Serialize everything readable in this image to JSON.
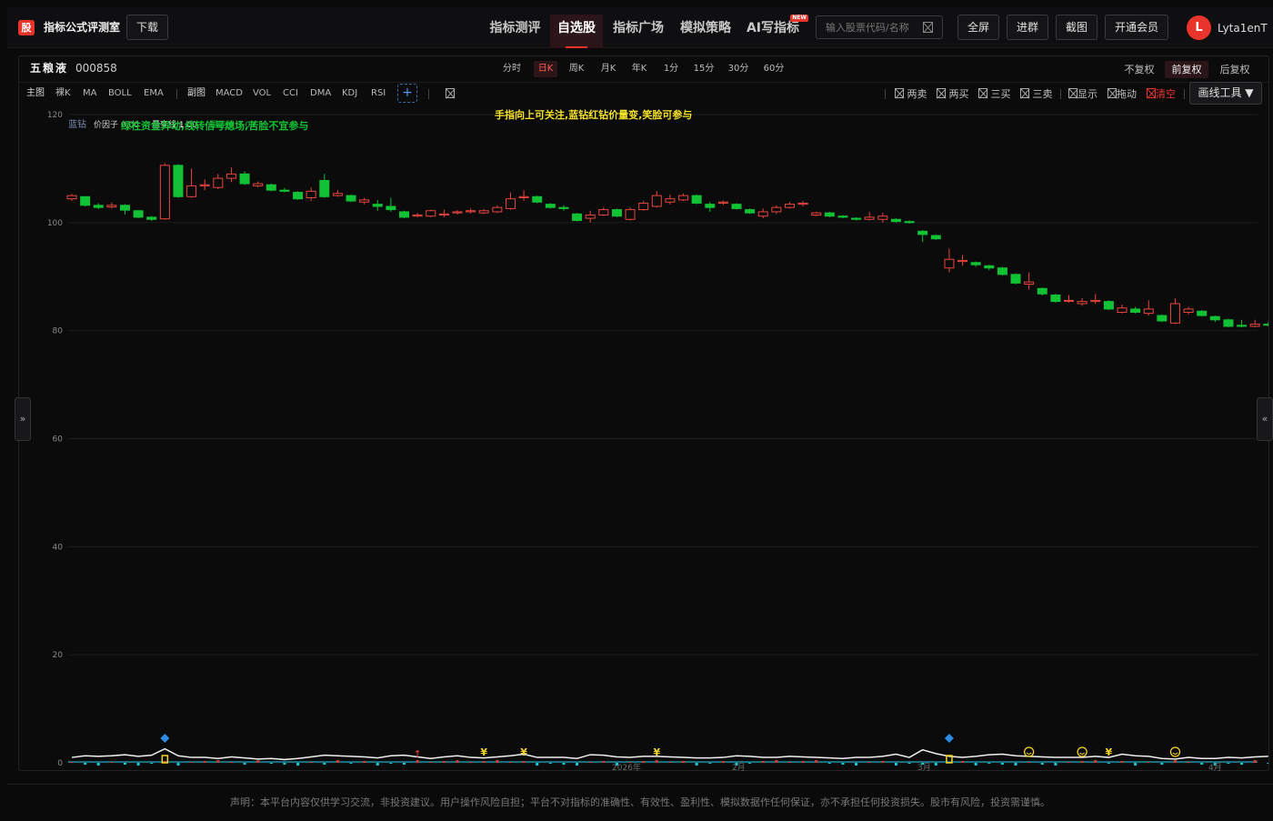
{
  "header": {
    "logo_text": "股",
    "app_title": "指标公式评测室",
    "download_label": "下载",
    "nav": [
      {
        "label": "指标测评",
        "active": false
      },
      {
        "label": "自选股",
        "active": true
      },
      {
        "label": "指标广场",
        "active": false
      },
      {
        "label": "模拟策略",
        "active": false
      },
      {
        "label": "AI写指标",
        "active": false,
        "badge": "NEW"
      }
    ],
    "search_placeholder": "输入股票代码/名称",
    "fullscreen_label": "全屏",
    "join_group_label": "进群",
    "screenshot_label": "截图",
    "membership_label": "开通会员",
    "avatar_letter": "L",
    "username": "Lyta1enT"
  },
  "stock": {
    "name": "五粮液",
    "code": "000858"
  },
  "periods": [
    {
      "label": "分时",
      "active": false
    },
    {
      "label": "日K",
      "active": true
    },
    {
      "label": "周K",
      "active": false
    },
    {
      "label": "月K",
      "active": false
    },
    {
      "label": "年K",
      "active": false
    },
    {
      "label": "1分",
      "active": false
    },
    {
      "label": "15分",
      "active": false
    },
    {
      "label": "30分",
      "active": false
    },
    {
      "label": "60分",
      "active": false
    }
  ],
  "adjustments": [
    {
      "label": "不复权",
      "active": false
    },
    {
      "label": "前复权",
      "active": true
    },
    {
      "label": "后复权",
      "active": false
    }
  ],
  "indicators": {
    "main_label": "主图",
    "main": [
      "裸K",
      "MA",
      "BOLL",
      "EMA"
    ],
    "sub_label": "副图",
    "sub": [
      "MACD",
      "VOL",
      "CCI",
      "DMA",
      "KDJ",
      "RSI"
    ],
    "add_label": "+"
  },
  "tools": [
    {
      "label": "两卖",
      "red": false
    },
    {
      "label": "两买",
      "red": false
    },
    {
      "label": "三买",
      "red": false
    },
    {
      "label": "三卖",
      "red": false
    },
    {
      "label": "显示",
      "red": false
    },
    {
      "label": "拖动",
      "red": false
    },
    {
      "label": "清空",
      "red": true
    }
  ],
  "draw_tools_label": "画线工具",
  "overlay": {
    "indicator_name": "蓝钻",
    "param1": "价因子 0.00",
    "param2": "量变线 1.00",
    "param3": "量能线 1.00",
    "green_text": "绿柱资金异动,线转信号熄场,苦脸不宜参与",
    "yellow_text": "手指向上可关注,蓝钻红钻价量变,笑脸可参与"
  },
  "colors": {
    "up": "#e8453c",
    "down": "#11c234",
    "accent": "#e8342b",
    "grid": "#1d1d20",
    "signal_yellow": "#f5d426",
    "signal_blue": "#2d8be0"
  },
  "chart_data": {
    "type": "candlestick",
    "y_axis": {
      "min": 0,
      "max": 120,
      "ticks": [
        0,
        20,
        40,
        60,
        80,
        100,
        120
      ]
    },
    "x_tick_labels": [
      "2026年",
      "2月",
      "3月",
      "4月"
    ],
    "candles": [
      {
        "o": 104.4,
        "c": 105.0,
        "h": 105.3,
        "l": 104.0
      },
      {
        "o": 104.8,
        "c": 103.2,
        "h": 104.9,
        "l": 103.0
      },
      {
        "o": 103.2,
        "c": 102.8,
        "h": 103.6,
        "l": 102.5
      },
      {
        "o": 102.9,
        "c": 103.2,
        "h": 103.7,
        "l": 102.6
      },
      {
        "o": 103.2,
        "c": 102.3,
        "h": 103.4,
        "l": 101.5
      },
      {
        "o": 102.2,
        "c": 101.0,
        "h": 102.3,
        "l": 100.8
      },
      {
        "o": 101.0,
        "c": 100.6,
        "h": 101.2,
        "l": 100.3
      },
      {
        "o": 100.7,
        "c": 110.6,
        "h": 111.0,
        "l": 100.5
      },
      {
        "o": 110.6,
        "c": 104.8,
        "h": 110.8,
        "l": 104.6
      },
      {
        "o": 104.8,
        "c": 106.8,
        "h": 110.0,
        "l": 104.6
      },
      {
        "o": 106.8,
        "c": 107.0,
        "h": 108.0,
        "l": 106.0
      },
      {
        "o": 106.5,
        "c": 108.2,
        "h": 109.0,
        "l": 106.2
      },
      {
        "o": 108.2,
        "c": 109.0,
        "h": 110.2,
        "l": 107.5
      },
      {
        "o": 109.0,
        "c": 107.2,
        "h": 109.5,
        "l": 107.0
      },
      {
        "o": 106.8,
        "c": 107.2,
        "h": 107.6,
        "l": 106.5
      },
      {
        "o": 107.0,
        "c": 106.0,
        "h": 107.2,
        "l": 105.8
      },
      {
        "o": 106.0,
        "c": 105.8,
        "h": 106.4,
        "l": 105.6
      },
      {
        "o": 105.6,
        "c": 104.4,
        "h": 105.8,
        "l": 104.2
      },
      {
        "o": 104.6,
        "c": 105.8,
        "h": 106.5,
        "l": 104.0
      },
      {
        "o": 107.8,
        "c": 104.8,
        "h": 109.0,
        "l": 104.6
      },
      {
        "o": 105.0,
        "c": 105.4,
        "h": 106.0,
        "l": 104.8
      },
      {
        "o": 105.0,
        "c": 104.0,
        "h": 105.2,
        "l": 103.8
      },
      {
        "o": 103.8,
        "c": 104.2,
        "h": 104.6,
        "l": 103.4
      },
      {
        "o": 103.4,
        "c": 103.0,
        "h": 104.2,
        "l": 102.2
      },
      {
        "o": 103.0,
        "c": 102.4,
        "h": 104.6,
        "l": 102.0
      },
      {
        "o": 102.0,
        "c": 101.0,
        "h": 102.2,
        "l": 100.8
      },
      {
        "o": 101.2,
        "c": 101.4,
        "h": 101.8,
        "l": 101.0
      },
      {
        "o": 101.2,
        "c": 102.2,
        "h": 102.4,
        "l": 101.0
      },
      {
        "o": 101.4,
        "c": 101.6,
        "h": 102.4,
        "l": 101.0
      },
      {
        "o": 101.8,
        "c": 102.0,
        "h": 102.3,
        "l": 101.5
      },
      {
        "o": 102.0,
        "c": 102.2,
        "h": 102.6,
        "l": 101.7
      },
      {
        "o": 101.8,
        "c": 102.2,
        "h": 102.5,
        "l": 101.6
      },
      {
        "o": 102.0,
        "c": 102.8,
        "h": 103.2,
        "l": 101.8
      },
      {
        "o": 102.6,
        "c": 104.4,
        "h": 105.6,
        "l": 102.4
      },
      {
        "o": 104.6,
        "c": 104.8,
        "h": 106.0,
        "l": 104.0
      },
      {
        "o": 104.8,
        "c": 103.8,
        "h": 105.0,
        "l": 103.6
      },
      {
        "o": 103.4,
        "c": 102.8,
        "h": 103.6,
        "l": 102.6
      },
      {
        "o": 102.8,
        "c": 102.6,
        "h": 103.2,
        "l": 102.2
      },
      {
        "o": 101.6,
        "c": 100.4,
        "h": 101.8,
        "l": 100.2
      },
      {
        "o": 100.8,
        "c": 101.4,
        "h": 102.2,
        "l": 100.0
      },
      {
        "o": 101.4,
        "c": 102.4,
        "h": 102.8,
        "l": 101.2
      },
      {
        "o": 102.4,
        "c": 101.2,
        "h": 102.6,
        "l": 101.0
      },
      {
        "o": 100.6,
        "c": 102.4,
        "h": 102.8,
        "l": 100.4
      },
      {
        "o": 102.4,
        "c": 103.6,
        "h": 104.0,
        "l": 102.2
      },
      {
        "o": 103.0,
        "c": 105.0,
        "h": 105.8,
        "l": 102.8
      },
      {
        "o": 103.8,
        "c": 104.4,
        "h": 105.2,
        "l": 103.4
      },
      {
        "o": 104.2,
        "c": 105.0,
        "h": 105.4,
        "l": 104.0
      },
      {
        "o": 105.0,
        "c": 103.6,
        "h": 105.2,
        "l": 103.4
      },
      {
        "o": 103.4,
        "c": 102.8,
        "h": 103.8,
        "l": 102.0
      },
      {
        "o": 103.6,
        "c": 103.8,
        "h": 104.1,
        "l": 103.3
      },
      {
        "o": 103.4,
        "c": 102.6,
        "h": 103.6,
        "l": 102.4
      },
      {
        "o": 102.4,
        "c": 101.8,
        "h": 102.6,
        "l": 101.6
      },
      {
        "o": 101.2,
        "c": 102.0,
        "h": 102.6,
        "l": 100.8
      },
      {
        "o": 102.0,
        "c": 102.8,
        "h": 103.2,
        "l": 101.6
      },
      {
        "o": 102.8,
        "c": 103.4,
        "h": 103.8,
        "l": 102.6
      },
      {
        "o": 103.4,
        "c": 103.6,
        "h": 104.0,
        "l": 103.0
      },
      {
        "o": 101.4,
        "c": 101.8,
        "h": 102.0,
        "l": 101.2
      },
      {
        "o": 101.8,
        "c": 101.2,
        "h": 102.0,
        "l": 101.0
      },
      {
        "o": 101.2,
        "c": 101.0,
        "h": 101.4,
        "l": 100.8
      },
      {
        "o": 100.8,
        "c": 100.6,
        "h": 101.0,
        "l": 100.4
      },
      {
        "o": 100.6,
        "c": 101.0,
        "h": 102.0,
        "l": 100.4
      },
      {
        "o": 100.6,
        "c": 101.2,
        "h": 101.8,
        "l": 100.0
      },
      {
        "o": 100.6,
        "c": 100.2,
        "h": 100.8,
        "l": 100.0
      },
      {
        "o": 100.2,
        "c": 100.0,
        "h": 100.4,
        "l": 99.8
      },
      {
        "o": 98.4,
        "c": 97.8,
        "h": 98.6,
        "l": 96.4
      },
      {
        "o": 97.6,
        "c": 97.0,
        "h": 97.8,
        "l": 96.8
      },
      {
        "o": 91.6,
        "c": 93.2,
        "h": 95.2,
        "l": 90.8
      },
      {
        "o": 92.8,
        "c": 93.0,
        "h": 94.0,
        "l": 92.0
      },
      {
        "o": 92.6,
        "c": 92.2,
        "h": 92.8,
        "l": 91.8
      },
      {
        "o": 92.0,
        "c": 91.6,
        "h": 92.2,
        "l": 91.2
      },
      {
        "o": 91.6,
        "c": 90.4,
        "h": 91.8,
        "l": 90.2
      },
      {
        "o": 90.4,
        "c": 88.8,
        "h": 90.6,
        "l": 88.6
      },
      {
        "o": 88.6,
        "c": 89.0,
        "h": 90.8,
        "l": 87.6
      },
      {
        "o": 87.8,
        "c": 86.8,
        "h": 88.0,
        "l": 86.5
      },
      {
        "o": 86.6,
        "c": 85.4,
        "h": 86.8,
        "l": 85.2
      },
      {
        "o": 85.6,
        "c": 85.6,
        "h": 86.6,
        "l": 85.2
      },
      {
        "o": 85.0,
        "c": 85.4,
        "h": 86.0,
        "l": 84.6
      },
      {
        "o": 85.4,
        "c": 85.6,
        "h": 86.8,
        "l": 85.0
      },
      {
        "o": 85.4,
        "c": 84.0,
        "h": 85.6,
        "l": 83.8
      },
      {
        "o": 83.4,
        "c": 84.2,
        "h": 84.8,
        "l": 83.2
      },
      {
        "o": 84.0,
        "c": 83.4,
        "h": 84.4,
        "l": 83.2
      },
      {
        "o": 83.2,
        "c": 84.0,
        "h": 85.6,
        "l": 82.8
      },
      {
        "o": 82.8,
        "c": 81.8,
        "h": 83.0,
        "l": 81.6
      },
      {
        "o": 81.4,
        "c": 85.0,
        "h": 86.0,
        "l": 81.2
      },
      {
        "o": 83.4,
        "c": 84.0,
        "h": 84.4,
        "l": 83.0
      },
      {
        "o": 83.6,
        "c": 82.8,
        "h": 83.8,
        "l": 82.6
      },
      {
        "o": 82.6,
        "c": 82.0,
        "h": 82.8,
        "l": 81.6
      },
      {
        "o": 82.0,
        "c": 80.8,
        "h": 82.2,
        "l": 80.6
      },
      {
        "o": 81.0,
        "c": 80.8,
        "h": 82.0,
        "l": 80.6
      },
      {
        "o": 80.8,
        "c": 81.2,
        "h": 82.0,
        "l": 80.6
      },
      {
        "o": 81.2,
        "c": 81.0,
        "h": 81.6,
        "l": 80.8
      }
    ],
    "indicator_line": [
      1.0,
      1.3,
      1.2,
      1.3,
      1.5,
      1.2,
      1.4,
      2.6,
      1.3,
      1.0,
      1.0,
      0.8,
      1.1,
      0.9,
      0.7,
      0.8,
      0.6,
      0.8,
      1.1,
      1.4,
      1.3,
      1.2,
      1.1,
      0.9,
      1.3,
      1.4,
      1.1,
      0.8,
      1.1,
      1.3,
      1.0,
      0.9,
      1.1,
      1.3,
      1.6,
      1.0,
      1.0,
      1.0,
      0.8,
      1.5,
      1.4,
      1.1,
      1.0,
      1.2,
      1.2,
      1.1,
      1.0,
      0.9,
      0.9,
      1.0,
      1.3,
      1.2,
      1.0,
      1.0,
      1.2,
      1.1,
      1.0,
      0.9,
      0.8,
      1.0,
      1.0,
      1.2,
      1.6,
      1.0,
      2.4,
      1.7,
      1.2,
      1.0,
      1.2,
      1.5,
      1.6,
      1.3,
      1.2,
      1.1,
      1.0,
      1.0,
      1.0,
      1.2,
      1.0,
      1.6,
      1.3,
      1.2,
      0.8,
      0.7,
      1.0,
      0.8,
      0.8,
      1.0,
      0.9,
      1.1,
      1.2
    ],
    "signals": [
      {
        "i": 7,
        "type": "diamond"
      },
      {
        "i": 26,
        "type": "arrow"
      },
      {
        "i": 31,
        "type": "yen"
      },
      {
        "i": 34,
        "type": "yen"
      },
      {
        "i": 44,
        "type": "yen"
      },
      {
        "i": 66,
        "type": "diamond"
      },
      {
        "i": 72,
        "type": "smiley"
      },
      {
        "i": 76,
        "type": "smiley"
      },
      {
        "i": 78,
        "type": "yen"
      },
      {
        "i": 83,
        "type": "smiley"
      }
    ]
  }
}
